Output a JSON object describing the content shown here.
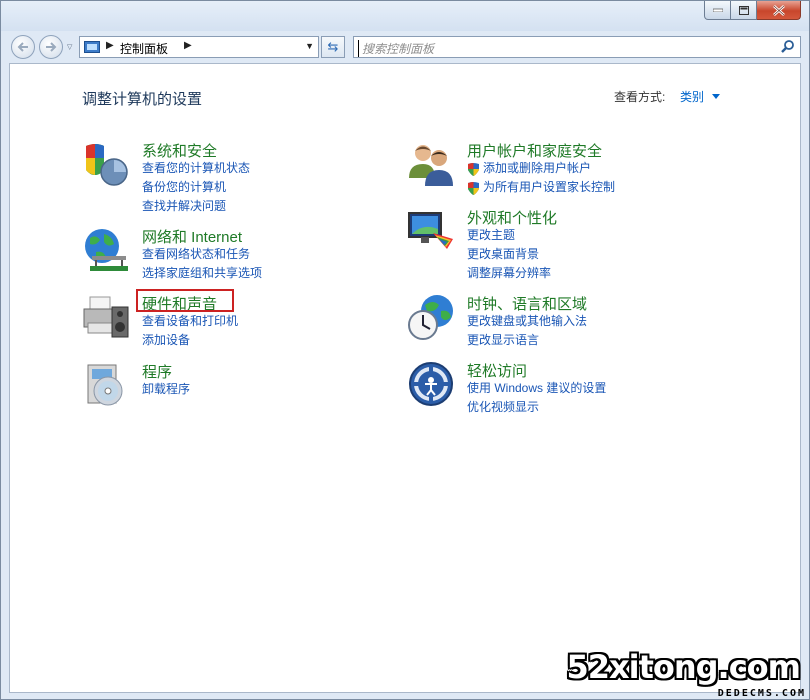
{
  "window": {
    "buttons": {
      "minimize": "minimize-icon",
      "maximize": "maximize-icon",
      "close": "close-icon"
    },
    "close_color": "#c8462c"
  },
  "nav": {
    "back_icon": "back-arrow-icon",
    "forward_icon": "forward-arrow-icon",
    "breadcrumb": "控制面板",
    "search_placeholder": "搜索控制面板"
  },
  "header": {
    "title": "调整计算机的设置",
    "view_by_label": "查看方式:",
    "view_by_value": "类别"
  },
  "categories": [
    {
      "title": "系统和安全",
      "icon": "shield-icon",
      "links": [
        "查看您的计算机状态",
        "备份您的计算机",
        "查找并解决问题"
      ]
    },
    {
      "title": "用户帐户和家庭安全",
      "icon": "users-icon",
      "links": [
        "添加或删除用户帐户",
        "为所有用户设置家长控制"
      ]
    },
    {
      "title": "网络和 Internet",
      "icon": "network-globe-icon",
      "links": [
        "查看网络状态和任务",
        "选择家庭组和共享选项"
      ]
    },
    {
      "title": "外观和个性化",
      "icon": "monitor-palette-icon",
      "links": [
        "更改主题",
        "更改桌面背景",
        "调整屏幕分辨率"
      ]
    },
    {
      "title": "硬件和声音",
      "icon": "printer-speaker-icon",
      "links": [
        "查看设备和打印机",
        "添加设备"
      ]
    },
    {
      "title": "时钟、语言和区域",
      "icon": "clock-globe-icon",
      "links": [
        "更改键盘或其他输入法",
        "更改显示语言"
      ]
    },
    {
      "title": "程序",
      "icon": "programs-disc-icon",
      "links": [
        "卸载程序"
      ]
    },
    {
      "title": "轻松访问",
      "icon": "ease-of-access-icon",
      "links": [
        "使用 Windows 建议的设置",
        "优化视频显示"
      ]
    }
  ],
  "watermark": {
    "text": "52xitong.com",
    "sub": "DEDECMS.COM"
  },
  "colors": {
    "category_title": "#1f7a27",
    "link": "#1a56b5",
    "highlight_box": "#cc2222"
  }
}
